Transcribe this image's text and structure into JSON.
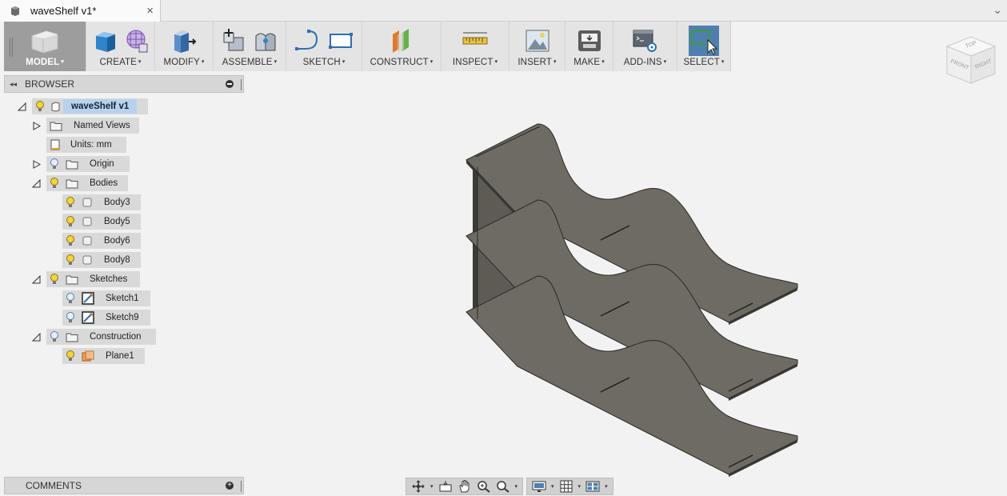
{
  "window": {
    "tab_title": "waveShelf v1*",
    "close_glyph": "×",
    "overflow_glyph": "⌄"
  },
  "toolbar": {
    "groups": [
      {
        "key": "model",
        "label": "MODEL",
        "icon": "model-workspace-icon"
      },
      {
        "key": "create",
        "label": "CREATE",
        "icon": "box-icon"
      },
      {
        "key": "modify",
        "label": "MODIFY",
        "icon": "press-pull-icon"
      },
      {
        "key": "assemble",
        "label": "ASSEMBLE",
        "icon": "new-component-icon"
      },
      {
        "key": "sketch",
        "label": "SKETCH",
        "icon": "sketch-line-icon"
      },
      {
        "key": "construct",
        "label": "CONSTRUCT",
        "icon": "offset-plane-icon"
      },
      {
        "key": "inspect",
        "label": "INSPECT",
        "icon": "measure-icon"
      },
      {
        "key": "insert",
        "label": "INSERT",
        "icon": "insert-image-icon"
      },
      {
        "key": "make",
        "label": "MAKE",
        "icon": "3d-print-icon"
      },
      {
        "key": "addins",
        "label": "ADD-INS",
        "icon": "scripts-icon"
      },
      {
        "key": "select",
        "label": "SELECT",
        "icon": "select-cursor-icon"
      }
    ],
    "caret": "▾"
  },
  "browser": {
    "title": "BROWSER",
    "collapse_glyph": "◂◂",
    "root": "waveShelf v1",
    "items": [
      {
        "label": "Named Views"
      },
      {
        "label": "Units: mm"
      },
      {
        "label": "Origin"
      },
      {
        "label": "Bodies"
      },
      {
        "label": "Body3"
      },
      {
        "label": "Body5"
      },
      {
        "label": "Body6"
      },
      {
        "label": "Body8"
      },
      {
        "label": "Sketches"
      },
      {
        "label": "Sketch1"
      },
      {
        "label": "Sketch9"
      },
      {
        "label": "Construction"
      },
      {
        "label": "Plane1"
      }
    ]
  },
  "comments": {
    "title": "COMMENTS",
    "add_glyph": "+"
  },
  "viewcube": {
    "top": "TOP",
    "front": "FRONT",
    "right": "RIGHT"
  },
  "colors": {
    "model_fill": "#6e6b63",
    "model_edge": "#2a2926",
    "select_active": "#4f7fae",
    "active_node": "#b8d2ee"
  }
}
